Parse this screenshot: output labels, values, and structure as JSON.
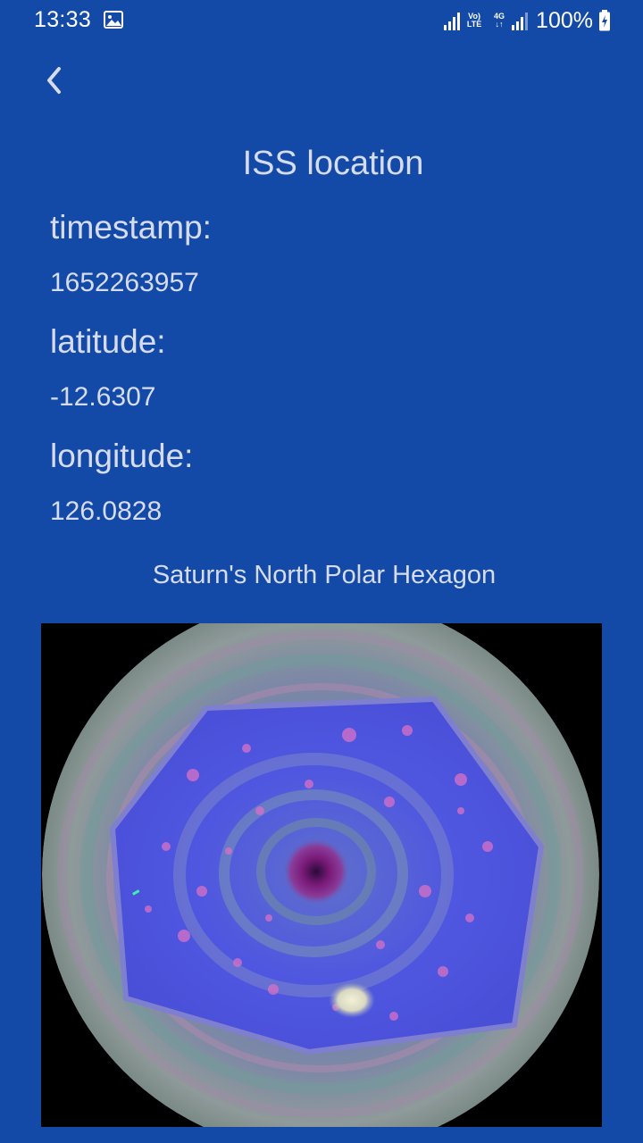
{
  "status_bar": {
    "time": "13:33",
    "battery_percent": "100%",
    "volte_label": "Vo) LTE",
    "network_label": "4G",
    "icons": [
      "gallery-icon",
      "signal-icon",
      "volte-icon",
      "4g-data-icon",
      "signal-icon",
      "battery-charging-icon"
    ]
  },
  "toolbar": {
    "back_icon": "chevron-left-icon"
  },
  "page": {
    "title": "ISS location",
    "timestamp_label": "timestamp:",
    "timestamp_value": "1652263957",
    "latitude_label": "latitude:",
    "latitude_value": "-12.6307",
    "longitude_label": "longitude:",
    "longitude_value": "126.0828"
  },
  "image": {
    "caption": "Saturn's North Polar Hexagon"
  },
  "colors": {
    "background": "#134aa8",
    "text": "#d6dced",
    "status_text": "#ffffff"
  }
}
